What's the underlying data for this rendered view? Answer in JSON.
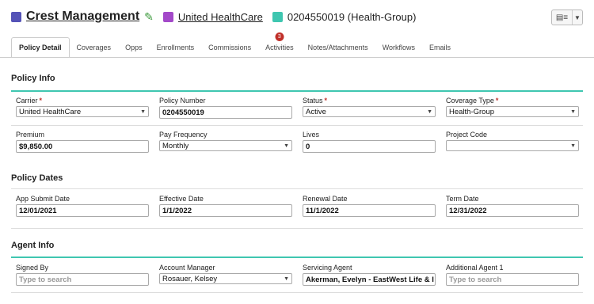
{
  "header": {
    "title": "Crest Management",
    "carrier_link": "United HealthCare",
    "policy_label": "0204550019 (Health-Group)",
    "colors": {
      "title_square": "#5553b7",
      "carrier_square": "#a349c9",
      "policy_square": "#3fc6b0"
    }
  },
  "toolbar": {
    "view_icon": "list-icon",
    "menu_icon": "caret-down-icon"
  },
  "tabs": [
    {
      "label": "Policy Detail",
      "active": true
    },
    {
      "label": "Coverages"
    },
    {
      "label": "Opps"
    },
    {
      "label": "Enrollments"
    },
    {
      "label": "Commissions"
    },
    {
      "label": "Activities",
      "badge": "3"
    },
    {
      "label": "Notes/Attachments"
    },
    {
      "label": "Workflows"
    },
    {
      "label": "Emails"
    }
  ],
  "policy_info": {
    "title": "Policy Info",
    "carrier": {
      "label": "Carrier",
      "value": "United HealthCare"
    },
    "policy_number": {
      "label": "Policy Number",
      "value": "0204550019"
    },
    "status": {
      "label": "Status",
      "value": "Active"
    },
    "coverage_type": {
      "label": "Coverage Type",
      "value": "Health-Group"
    },
    "premium": {
      "label": "Premium",
      "value": "$9,850.00"
    },
    "pay_frequency": {
      "label": "Pay Frequency",
      "value": "Monthly"
    },
    "lives": {
      "label": "Lives",
      "value": "0"
    },
    "project_code": {
      "label": "Project Code",
      "value": ""
    }
  },
  "policy_dates": {
    "title": "Policy Dates",
    "app_submit_date": {
      "label": "App Submit Date",
      "value": "12/01/2021"
    },
    "effective_date": {
      "label": "Effective Date",
      "value": "1/1/2022"
    },
    "renewal_date": {
      "label": "Renewal Date",
      "value": "11/1/2022"
    },
    "term_date": {
      "label": "Term Date",
      "value": "12/31/2022"
    }
  },
  "agent_info": {
    "title": "Agent Info",
    "signed_by": {
      "label": "Signed By",
      "placeholder": "Type to search"
    },
    "account_manager": {
      "label": "Account Manager",
      "value": "Rosauer, Kelsey"
    },
    "servicing_agent": {
      "label": "Servicing Agent",
      "value": "Akerman, Evelyn  - EastWest Life & I"
    },
    "additional_agent_1": {
      "label": "Additional Agent 1",
      "placeholder": "Type to search"
    }
  }
}
